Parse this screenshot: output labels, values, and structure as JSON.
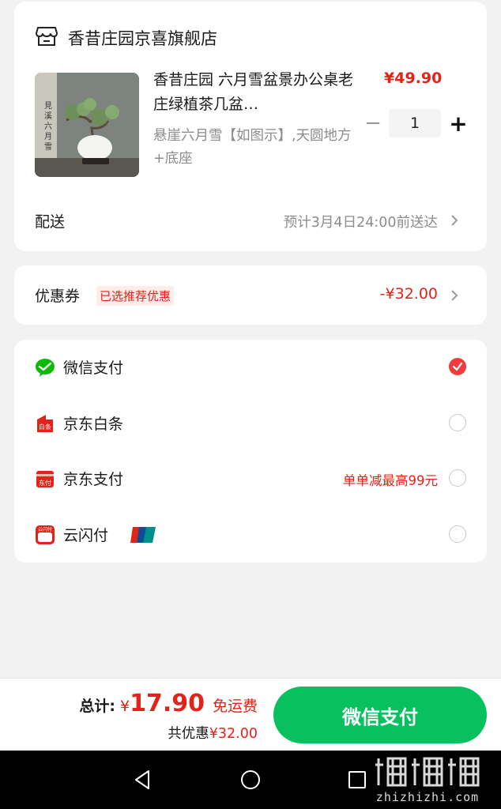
{
  "store": {
    "name": "香昔庄园京喜旗舰店",
    "icon": "store-icon"
  },
  "product": {
    "title": "香昔庄园 六月雪盆景办公桌老庄绿植茶几盆…",
    "price": "¥49.90",
    "spec": "悬崖六月雪【如图示】,天圆地方+底座",
    "quantity": "1",
    "minus_label": "−",
    "plus_label": "+",
    "thumb_calligraphy": "見溪六月雪"
  },
  "delivery": {
    "label": "配送",
    "value": "预计3月4日24:00前送达"
  },
  "coupon": {
    "label": "优惠券",
    "tag": "已选推荐优惠",
    "value": "-¥32.00"
  },
  "payment_methods": [
    {
      "name": "微信支付",
      "icon": "wechat-pay-icon",
      "selected": true,
      "promo": ""
    },
    {
      "name": "京东白条",
      "icon": "jd-baitiao-icon",
      "selected": false,
      "promo": ""
    },
    {
      "name": "京东支付",
      "icon": "jd-pay-icon",
      "selected": false,
      "promo": "单单减最高99元"
    },
    {
      "name": "云闪付",
      "icon": "cloud-quickpass-icon",
      "selected": false,
      "promo": "",
      "badge": "unionpay-badge-icon"
    }
  ],
  "summary": {
    "total_label": "总计:",
    "currency": "¥",
    "total_amount": "17.90",
    "shipping": "免运费",
    "saved_label": "共优惠",
    "saved_amount": "¥32.00",
    "pay_button": "微信支付"
  },
  "watermark": {
    "text": "zhizhizhi.com"
  },
  "colors": {
    "accent_red": "#e2231a",
    "pay_green": "#07c15f",
    "background": "#f2f2f2"
  }
}
